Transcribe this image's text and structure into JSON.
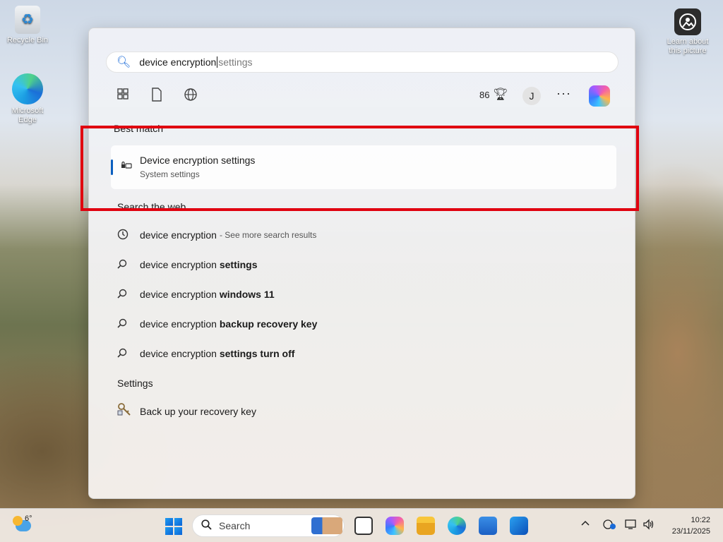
{
  "desktop": {
    "icons": [
      {
        "label": "Recycle Bin"
      },
      {
        "label": "Microsoft Edge"
      },
      {
        "label": "Learn about this picture"
      }
    ]
  },
  "search": {
    "typed": "device encryption",
    "suggestion": " settings"
  },
  "toolbar": {
    "points": "86",
    "avatar_initial": "J",
    "more": "···"
  },
  "best_match": {
    "heading": "Best match",
    "title": "Device encryption settings",
    "subtitle": "System settings"
  },
  "web": {
    "heading": "Search the web",
    "items": [
      {
        "normal": "device encryption",
        "bold": "",
        "extra": "- See more search results",
        "icon": "history-icon"
      },
      {
        "normal": "device encryption ",
        "bold": "settings",
        "extra": "",
        "icon": "search-icon"
      },
      {
        "normal": "device encryption ",
        "bold": "windows 11",
        "extra": "",
        "icon": "search-icon"
      },
      {
        "normal": "device encryption ",
        "bold": "backup recovery key",
        "extra": "",
        "icon": "search-icon"
      },
      {
        "normal": "device encryption ",
        "bold": "settings turn off",
        "extra": "",
        "icon": "search-icon"
      }
    ]
  },
  "settings_section": {
    "heading": "Settings",
    "item": "Back up your recovery key"
  },
  "taskbar": {
    "weather_temp": "6°",
    "search_label": "Search",
    "time": "10:22",
    "date": "23/11/2025"
  },
  "colors": {
    "accent": "#0b5fbf",
    "highlight": "#e0000f"
  }
}
